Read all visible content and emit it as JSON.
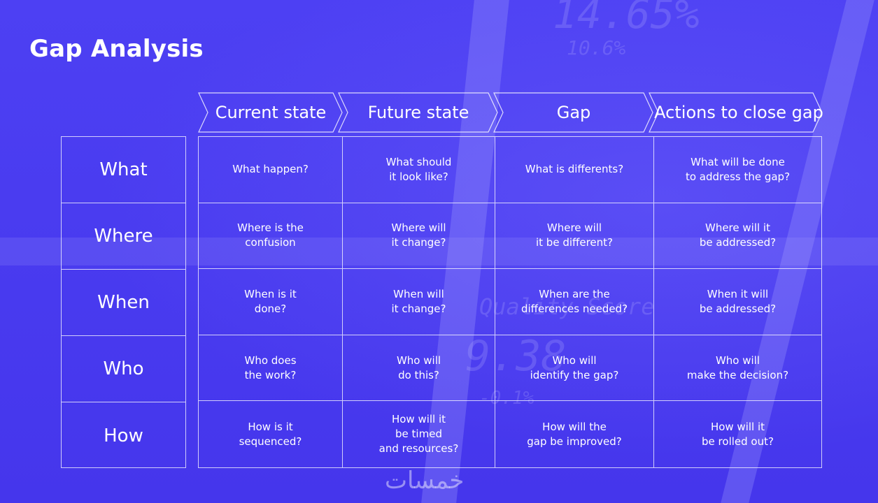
{
  "title": "Gap Analysis",
  "columns": [
    "Current state",
    "Future state",
    "Gap",
    "Actions to close gap"
  ],
  "rows": [
    {
      "label": "What",
      "cells": [
        "What happen?",
        "What should\nit look like?",
        "What is differents?",
        "What will be done\nto address the gap?"
      ]
    },
    {
      "label": "Where",
      "cells": [
        "Where is the\nconfusion",
        "Where will\nit change?",
        "Where will\nit be different?",
        "Where will it\nbe addressed?"
      ]
    },
    {
      "label": "When",
      "cells": [
        "When is it\ndone?",
        "When will\nit change?",
        "When are the\ndifferences needed?",
        "When it will\nbe addressed?"
      ]
    },
    {
      "label": "Who",
      "cells": [
        "Who does\nthe work?",
        "Who will\ndo this?",
        "Who will\nidentify the gap?",
        "Who will\nmake the decision?"
      ]
    },
    {
      "label": "How",
      "cells": [
        "How is it\nsequenced?",
        "How will it\nbe timed\nand resources?",
        "How will the\ngap be improved?",
        "How will it\nbe rolled out?"
      ]
    }
  ],
  "background_text": [
    "14.65%",
    "10.6%",
    "Quality Score",
    "9.38",
    "-0.1%"
  ],
  "watermark": "خمسات",
  "colors": {
    "background": "#4a3cf2",
    "text": "#ffffff",
    "lines": "#ffffff"
  }
}
